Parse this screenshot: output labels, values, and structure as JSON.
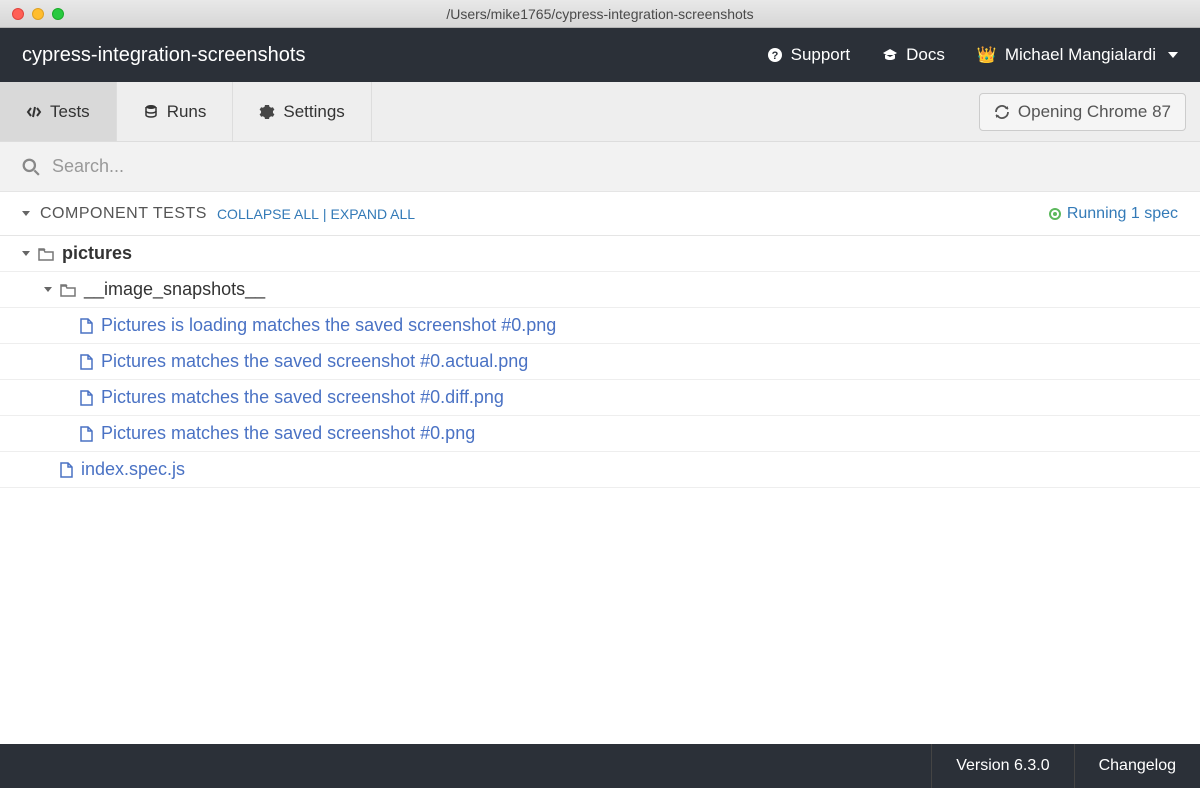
{
  "titlebar": {
    "path": "/Users/mike1765/cypress-integration-screenshots"
  },
  "darkbar": {
    "project_name": "cypress-integration-screenshots",
    "support": "Support",
    "docs": "Docs",
    "user_name": "Michael Mangialardi"
  },
  "tabs": {
    "tests": "Tests",
    "runs": "Runs",
    "settings": "Settings"
  },
  "opening": {
    "label": "Opening Chrome 87"
  },
  "search": {
    "placeholder": "Search..."
  },
  "section": {
    "title": "COMPONENT TESTS",
    "collapse": "COLLAPSE ALL",
    "expand": "EXPAND ALL",
    "running": "Running 1 spec"
  },
  "tree": {
    "folder_pictures": "pictures",
    "folder_snapshots": "__image_snapshots__",
    "files": [
      "Pictures is loading matches the saved screenshot #0.png",
      "Pictures matches the saved screenshot #0.actual.png",
      "Pictures matches the saved screenshot #0.diff.png",
      "Pictures matches the saved screenshot #0.png"
    ],
    "root_file": "index.spec.js"
  },
  "footer": {
    "version": "Version 6.3.0",
    "changelog": "Changelog"
  }
}
